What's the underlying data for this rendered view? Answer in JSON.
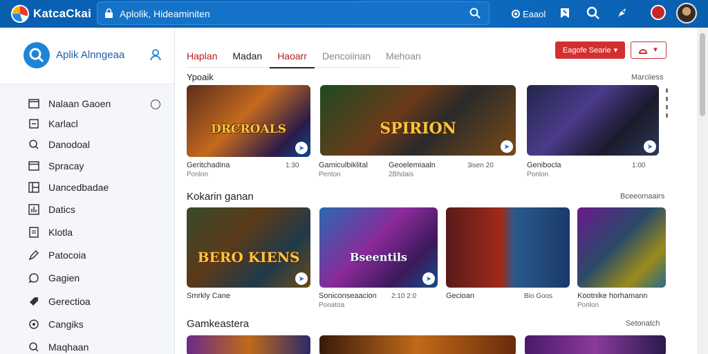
{
  "topbar": {
    "brand": "KatcaCkai",
    "search_value": "Aplolik, Hideaminiten",
    "action_label": "Eaaol",
    "logo_icon": "brand-logo",
    "colors": {
      "bar": "#0d6dc4",
      "accent": "#d32f2f"
    }
  },
  "sidebar": {
    "title": "Aplik Alnngeaa",
    "items": [
      {
        "label": "Nalaan Gaoen",
        "icon": "folder-icon"
      },
      {
        "label": "Karlacl",
        "icon": "edit-box-icon"
      },
      {
        "label": "Danodoal",
        "icon": "search-icon"
      },
      {
        "label": "Spracay",
        "icon": "window-icon"
      },
      {
        "label": "Uancedbadae",
        "icon": "grid-icon"
      },
      {
        "label": "Datics",
        "icon": "chart-icon"
      },
      {
        "label": "Klotla",
        "icon": "document-icon"
      },
      {
        "label": "Patocoia",
        "icon": "pencil-icon"
      },
      {
        "label": "Gagien",
        "icon": "chat-icon"
      },
      {
        "label": "Gerectioa",
        "icon": "tag-icon"
      },
      {
        "label": "Cangiks",
        "icon": "clock-icon"
      },
      {
        "label": "Maqhaan",
        "icon": "search-icon"
      }
    ]
  },
  "tabs": [
    "Haplan",
    "Madan",
    "Haoarr",
    "Dencoiinan",
    "Mehoan"
  ],
  "buttons": {
    "primary": "Eagofe Searie",
    "secondary_icon": "notification-icon"
  },
  "sections": [
    {
      "title": "Ypoaik",
      "more": "Marciiess",
      "cards": [
        {
          "art": "DRCROALS",
          "title": "Geritchadina",
          "sub": "Ponlon",
          "value": "1:30"
        },
        {
          "art": "SPIRION",
          "title": "Gamiculbiklital",
          "sub": "Penton",
          "value": ""
        },
        {
          "art": "",
          "title": "Genibocla",
          "sub": "Ponlon",
          "value": "1:00"
        }
      ],
      "middle_caption": {
        "title": "Geoelemiaaln",
        "sub": "2Bhdais",
        "value": "3isen 20"
      }
    },
    {
      "title": "Kokarin ganan",
      "more": "Bceeomaairs",
      "cards": [
        {
          "art": "BERO KIENS",
          "title": "Smrkly Cane",
          "sub": "",
          "value": ""
        },
        {
          "art": "Bseentils",
          "title": "Soniconseaacion",
          "sub": "Ponatoa",
          "value": "2:10   2:0"
        },
        {
          "art": "",
          "title": "Gecioan",
          "sub": "",
          "value": "Bio Goos"
        },
        {
          "art": "",
          "title": "Kootnike horhamann",
          "sub": "Ponlon",
          "value": ""
        }
      ]
    },
    {
      "title": "Gamkeastera",
      "more": "Setonatch",
      "cards": []
    }
  ]
}
